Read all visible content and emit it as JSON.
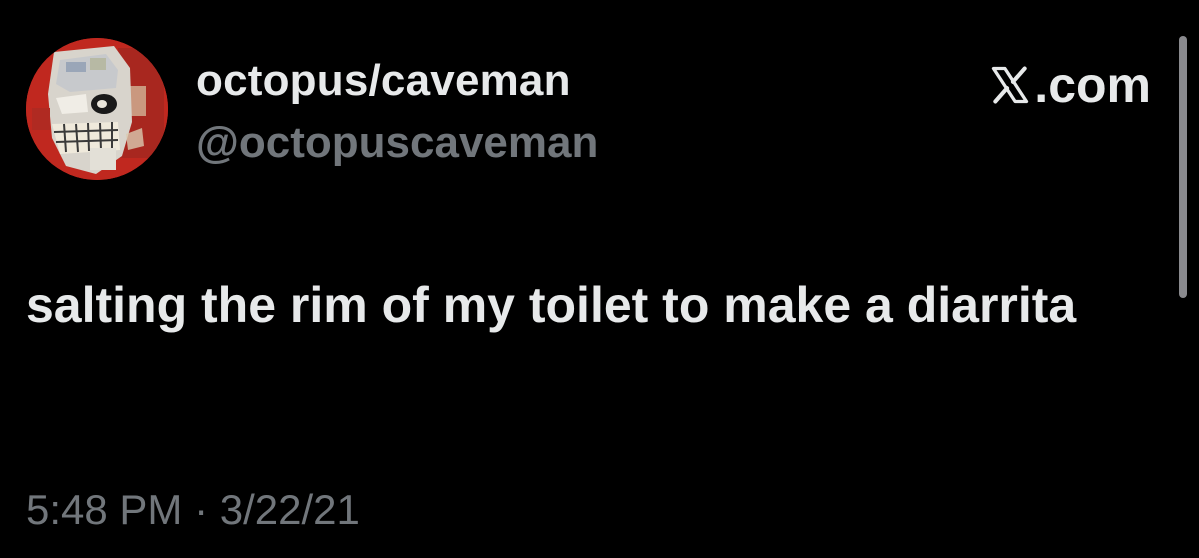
{
  "tweet": {
    "author": {
      "display_name": "octopus/caveman",
      "handle": "@octopuscaveman",
      "avatar_icon": "skull-painting-avatar"
    },
    "brand": {
      "label": ".com",
      "icon": "x-logo-icon"
    },
    "text": "salting the rim of my toilet to make a diarrita",
    "timestamp": "5:48 PM · 3/22/21"
  },
  "colors": {
    "background": "#000000",
    "primary_text": "#e7e9ea",
    "secondary_text": "#71767b",
    "avatar_red": "#c0281f",
    "scrollbar": "#8a8a8e"
  }
}
